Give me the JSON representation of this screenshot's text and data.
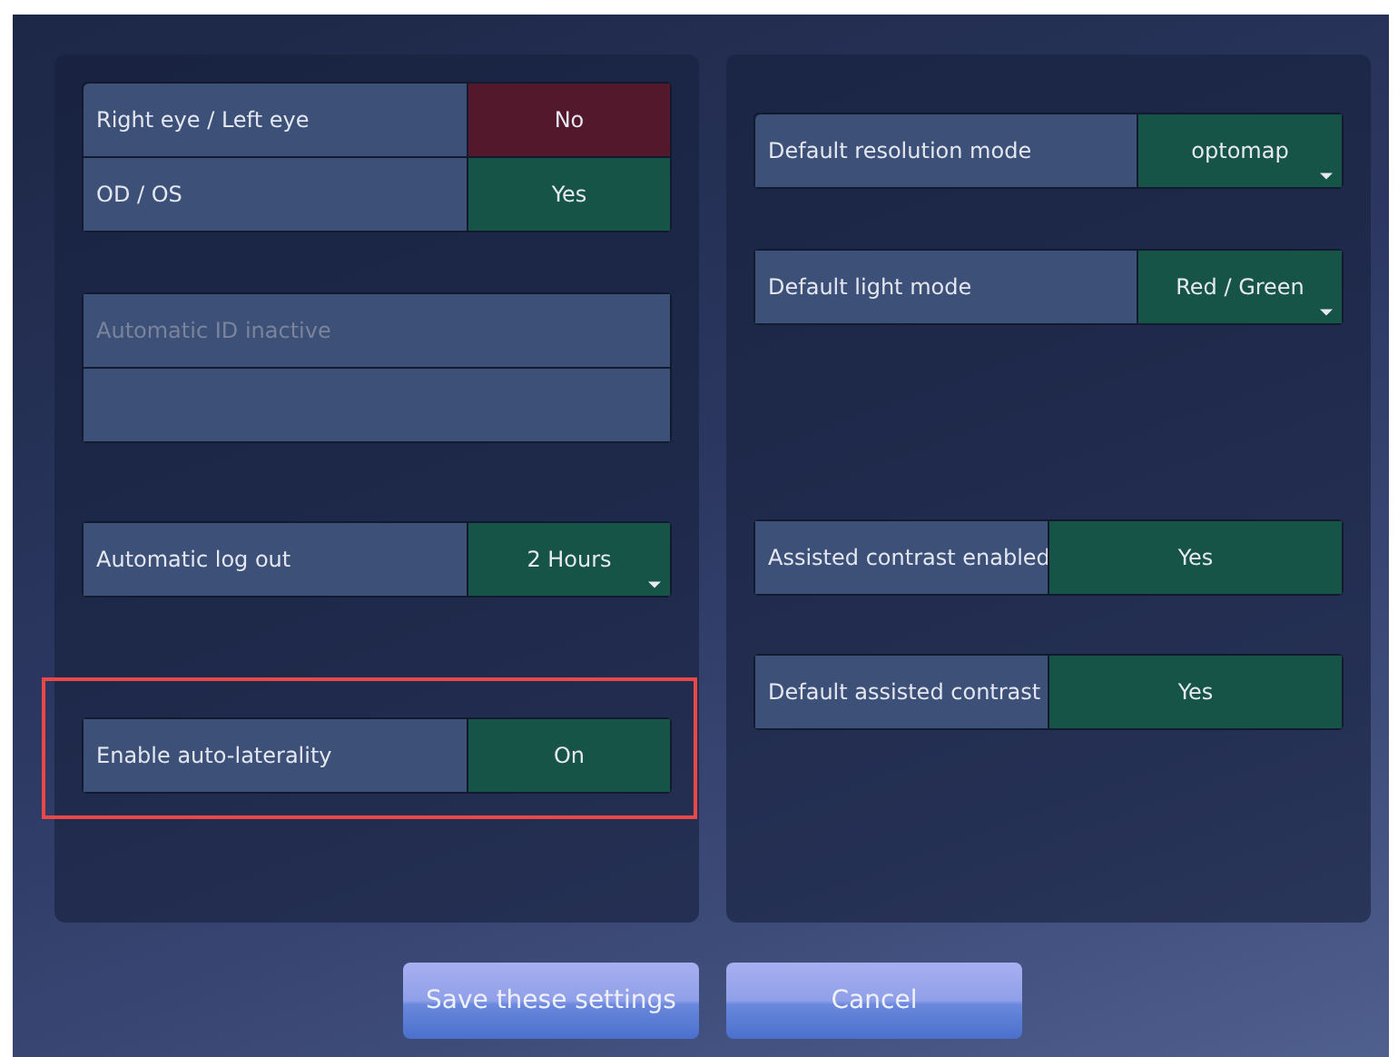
{
  "panels": [
    {
      "groups": [
        {
          "rows": [
            {
              "label": "Right eye / Left eye",
              "disabled": false,
              "value": {
                "kind": "toggle",
                "text": "No",
                "on": false
              }
            },
            {
              "label": "OD / OS",
              "disabled": false,
              "value": {
                "kind": "toggle",
                "text": "Yes",
                "on": true
              }
            }
          ]
        },
        {
          "rows": [
            {
              "label": "Automatic ID inactive",
              "disabled": true
            },
            {}
          ]
        },
        {
          "rows": [
            {
              "label": "Automatic log out",
              "disabled": false,
              "value": {
                "kind": "dropdown",
                "text": "2 Hours"
              }
            }
          ]
        },
        {
          "rows": [
            {
              "label": "Enable auto-laterality",
              "disabled": false,
              "value": {
                "kind": "toggle",
                "text": "On",
                "on": true
              }
            }
          ],
          "highlighted": true
        }
      ]
    },
    {
      "groups": [
        {
          "rows": [
            {
              "label": "Default resolution mode",
              "disabled": false,
              "value": {
                "kind": "dropdown",
                "text": "optomap"
              }
            }
          ]
        },
        {
          "rows": [
            {
              "label": "Default light mode",
              "disabled": false,
              "value": {
                "kind": "dropdown",
                "text": "Red / Green"
              }
            }
          ]
        },
        {
          "rows": [
            {
              "label": "Assisted contrast enabled",
              "disabled": false,
              "value": {
                "kind": "toggle",
                "text": "Yes",
                "on": true
              }
            }
          ]
        },
        {
          "rows": [
            {
              "label": "Default assisted contrast",
              "disabled": false,
              "value": {
                "kind": "toggle",
                "text": "Yes",
                "on": true
              }
            }
          ]
        }
      ]
    }
  ],
  "buttons": [
    "Save these settings",
    "Cancel"
  ]
}
